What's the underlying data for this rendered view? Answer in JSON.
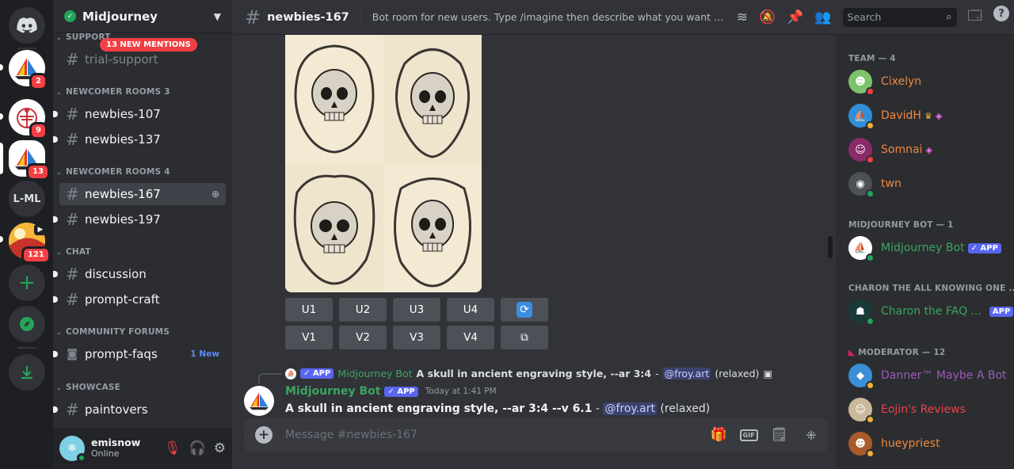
{
  "servers": {
    "badges": [
      "2",
      "9",
      "13",
      "121"
    ],
    "lml_label": "L-ML"
  },
  "guild": {
    "name": "Midjourney"
  },
  "sidebar": {
    "new_mentions": "13 NEW MENTIONS",
    "categories": {
      "support": "SUPPORT",
      "newcomer3": "NEWCOMER ROOMS 3",
      "newcomer4": "NEWCOMER ROOMS 4",
      "chat": "CHAT",
      "forums": "COMMUNITY FORUMS",
      "showcase": "SHOWCASE"
    },
    "channels": {
      "trial_support": "trial-support",
      "newbies107": "newbies-107",
      "newbies137": "newbies-137",
      "newbies167": "newbies-167",
      "newbies197": "newbies-197",
      "discussion": "discussion",
      "prompt_craft": "prompt-craft",
      "prompt_faqs": "prompt-faqs",
      "paintovers": "paintovers"
    },
    "new_label": "1 New"
  },
  "user": {
    "name": "emisnow",
    "status": "Online"
  },
  "header": {
    "channel": "newbies-167",
    "topic": "Bot room for new users. Type /imagine then describe what you want to draw. ...",
    "search_placeholder": "Search"
  },
  "message": {
    "buttons_row1": [
      "U1",
      "U2",
      "U3",
      "U4"
    ],
    "buttons_row2": [
      "V1",
      "V2",
      "V3",
      "V4"
    ],
    "app_tag": "APP",
    "reply_author": "Midjourney Bot",
    "reply_prompt": "A skull in ancient engraving style, --ar 3:4",
    "reply_dash": "-",
    "reply_mention": "@froy.art",
    "reply_mode": "(relaxed)",
    "author": "Midjourney Bot",
    "timestamp": "Today at 1:41 PM",
    "prompt": "A skull in ancient engraving style, --ar 3:4 --v 6.1",
    "dash": "-",
    "mention": "@froy.art",
    "mode": "(relaxed)"
  },
  "composer": {
    "placeholder": "Message #newbies-167",
    "gif": "GIF"
  },
  "members": {
    "groups": {
      "team": "TEAM — 4",
      "bot": "MIDJOURNEY BOT — 1",
      "charon": "CHARON THE ALL KNOWING ONE ...",
      "moderator": "MODERATOR — 12"
    },
    "team": [
      "Cixelyn",
      "DavidH",
      "Somnai",
      "twn"
    ],
    "bot": "Midjourney Bot",
    "bot_tag": "APP",
    "charon": "Charon the FAQ ...",
    "charon_tag": "APP",
    "moderators": [
      "Danner™ Maybe A Bot",
      "Eojin's Reviews",
      "hueypriest"
    ]
  },
  "colors": {
    "accent": "#5865f2",
    "online": "#23a55a",
    "danger": "#f23f43",
    "team_name": "#f0883e",
    "bot_name": "#3ba55c",
    "moderator_purple": "#9b59b6",
    "moderator_red": "#ed4245"
  }
}
